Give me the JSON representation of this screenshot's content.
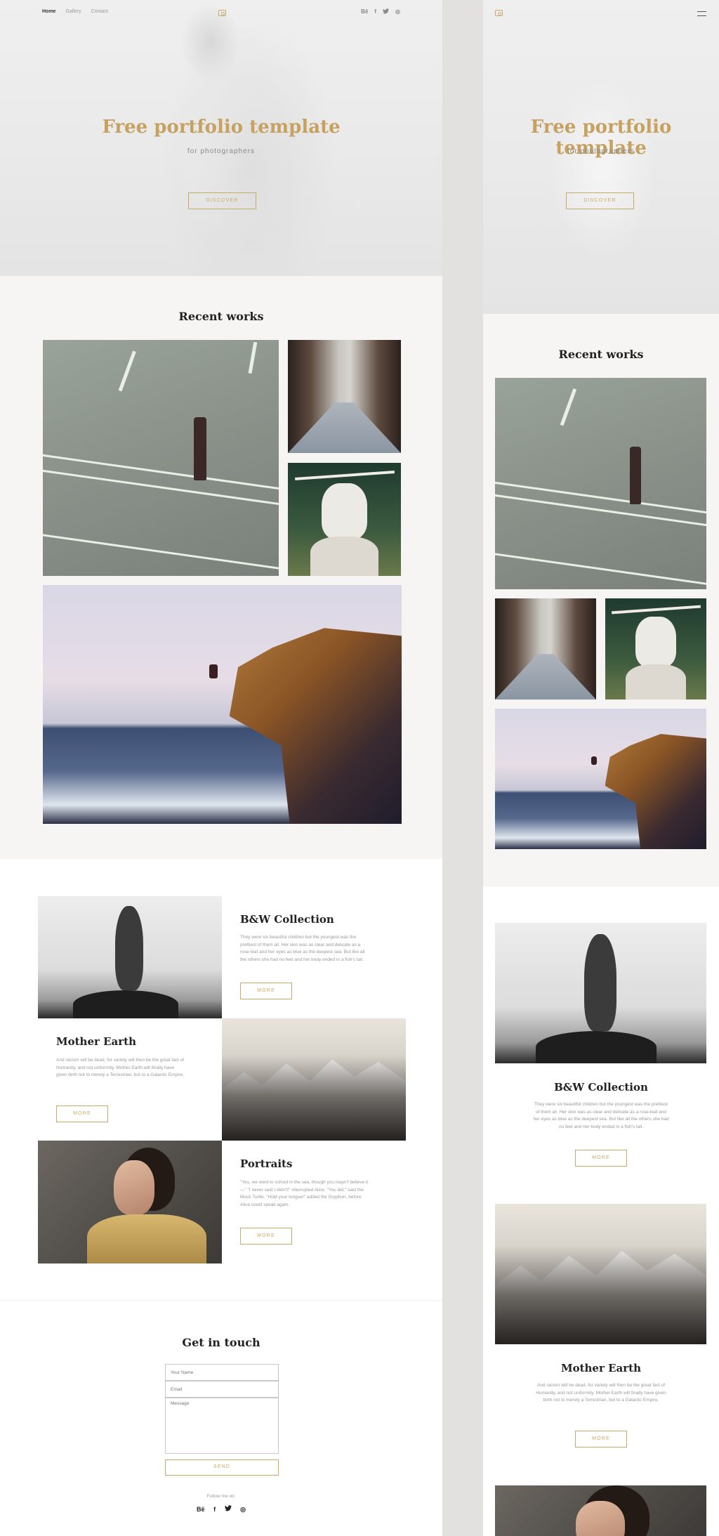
{
  "desktop": {
    "nav": {
      "home": "Home",
      "gallery": "Gallery",
      "contact": "Contact"
    },
    "social": [
      "Bē",
      "f",
      "t",
      "◎"
    ],
    "hero": {
      "title": "Free portfolio template",
      "subtitle": "for photographers",
      "button": "DISCOVER"
    },
    "recent_title": "Recent works",
    "collections": [
      {
        "title": "B&W Collection",
        "text": "They were six beautiful children but the youngest was the prettiest of them all. Her skin was as clear and delicate as a rose-leaf and her eyes as blue as the deepest sea. But like all the others she had no feet and her body ended in a fish's tail.",
        "button": "MORE"
      },
      {
        "title": "Mother Earth",
        "text": "And racism will be dead, for variety will then be the great fact of Humanity, and not uniformity. Mother Earth will finally have given birth not to merely a Terrestrian, but to a Galactic Empire.",
        "button": "MORE"
      },
      {
        "title": "Portraits",
        "text": "\"Yes, we went to school in the sea, though you mayn't believe it—\" \"I never said I didn't!\" interrupted Alice. \"You did,\" said the Mock Turtle. \"Hold your tongue!\" added the Gryphon, before Alice could speak again.",
        "button": "MORE"
      }
    ],
    "contact": {
      "title": "Get in touch",
      "name_placeholder": "Your Name",
      "email_placeholder": "Email",
      "message_placeholder": "Message",
      "send": "SEND",
      "follow": "Follow me on:",
      "social": [
        "Bē",
        "f",
        "t",
        "◎"
      ]
    }
  },
  "mobile": {
    "hero": {
      "title": "Free portfolio template",
      "subtitle": "for photographers",
      "button": "DISCOVER"
    },
    "recent_title": "Recent works",
    "collections": [
      {
        "title": "B&W Collection",
        "text": "They were six beautiful children but the youngest was the prettiest of them all. Her skin was as clear and delicate as a rose-leaf and her eyes as blue as the deepest sea. But like all the others she had no feet and her body ended in a fish's tail.",
        "button": "MORE"
      },
      {
        "title": "Mother Earth",
        "text": "And racism will be dead, for variety will then be the great fact of Humanity, and not uniformity. Mother Earth will finally have given birth not to merely a Terrestrian, but to a Galactic Empire.",
        "button": "MORE"
      }
    ]
  },
  "colors": {
    "accent": "#c9a96a",
    "title_gold": "#c6a15f",
    "section_bg": "#f6f5f3",
    "page_bg": "#e2e1df"
  }
}
